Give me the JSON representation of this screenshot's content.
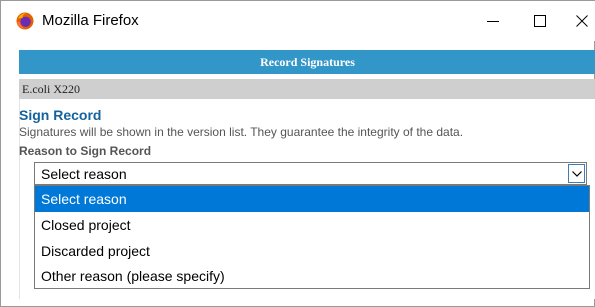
{
  "window": {
    "title": "Mozilla Firefox",
    "controls": {
      "minimize": "minimize-icon",
      "maximize": "maximize-icon",
      "close": "close-icon"
    }
  },
  "dialog": {
    "header": "Record Signatures",
    "record_name": "E.coli X220",
    "heading": "Sign Record",
    "description": "Signatures will be shown in the version list. They guarantee the integrity of the data.",
    "reason_label": "Reason to Sign Record",
    "reason_select": {
      "selected_value": "Select reason",
      "options": [
        "Select reason",
        "Closed project",
        "Discarded project",
        "Other reason (please specify)"
      ],
      "highlighted_index": 0
    }
  },
  "colors": {
    "header_bar": "#3396c8",
    "record_bar": "#cfcfcf",
    "heading_text": "#14629e",
    "option_highlight": "#0078d7"
  }
}
